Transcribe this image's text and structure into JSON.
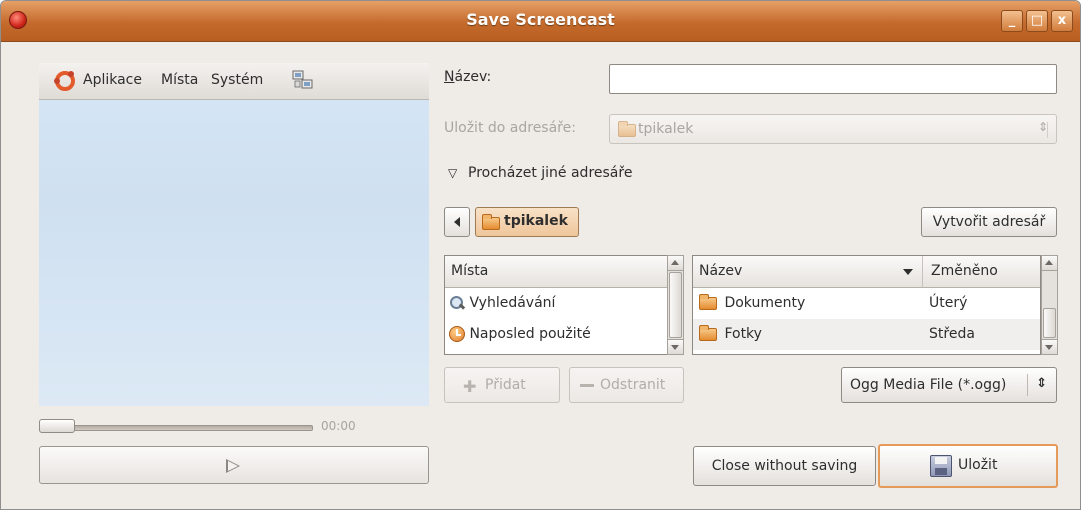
{
  "window": {
    "title": "Save Screencast",
    "buttons": {
      "minimize": "_",
      "maximize": "□",
      "close": "x"
    }
  },
  "preview": {
    "panel": {
      "menus": [
        "Aplikace",
        "Místa",
        "Systém"
      ]
    },
    "time": "00:00"
  },
  "form": {
    "name_label": "Název:",
    "name_value": "",
    "save_in_label": "Uložit do adresáře:",
    "save_in_value": "tpikalek",
    "browse_label": "Procházet jiné adresáře",
    "path_button": "tpikalek",
    "create_folder": "Vytvořit adresář"
  },
  "places": {
    "header": "Místa",
    "items": [
      {
        "label": "Vyhledávání",
        "icon": "search-icon"
      },
      {
        "label": "Naposled použité",
        "icon": "recent-icon"
      }
    ],
    "add_button": "Přidat",
    "remove_button": "Odstranit"
  },
  "files": {
    "headers": {
      "name": "Název",
      "modified": "Změněno"
    },
    "rows": [
      {
        "name": "Dokumenty",
        "modified": "Úterý"
      },
      {
        "name": "Fotky",
        "modified": "Středa"
      }
    ]
  },
  "filter": {
    "selected": "Ogg Media File (*.ogg)"
  },
  "actions": {
    "close_without_saving": "Close without saving",
    "save": "Uložit"
  },
  "colors": {
    "titlebar": "#c46a2c",
    "accent": "#e07a2a",
    "preview_bg": "#d6e6f5"
  }
}
